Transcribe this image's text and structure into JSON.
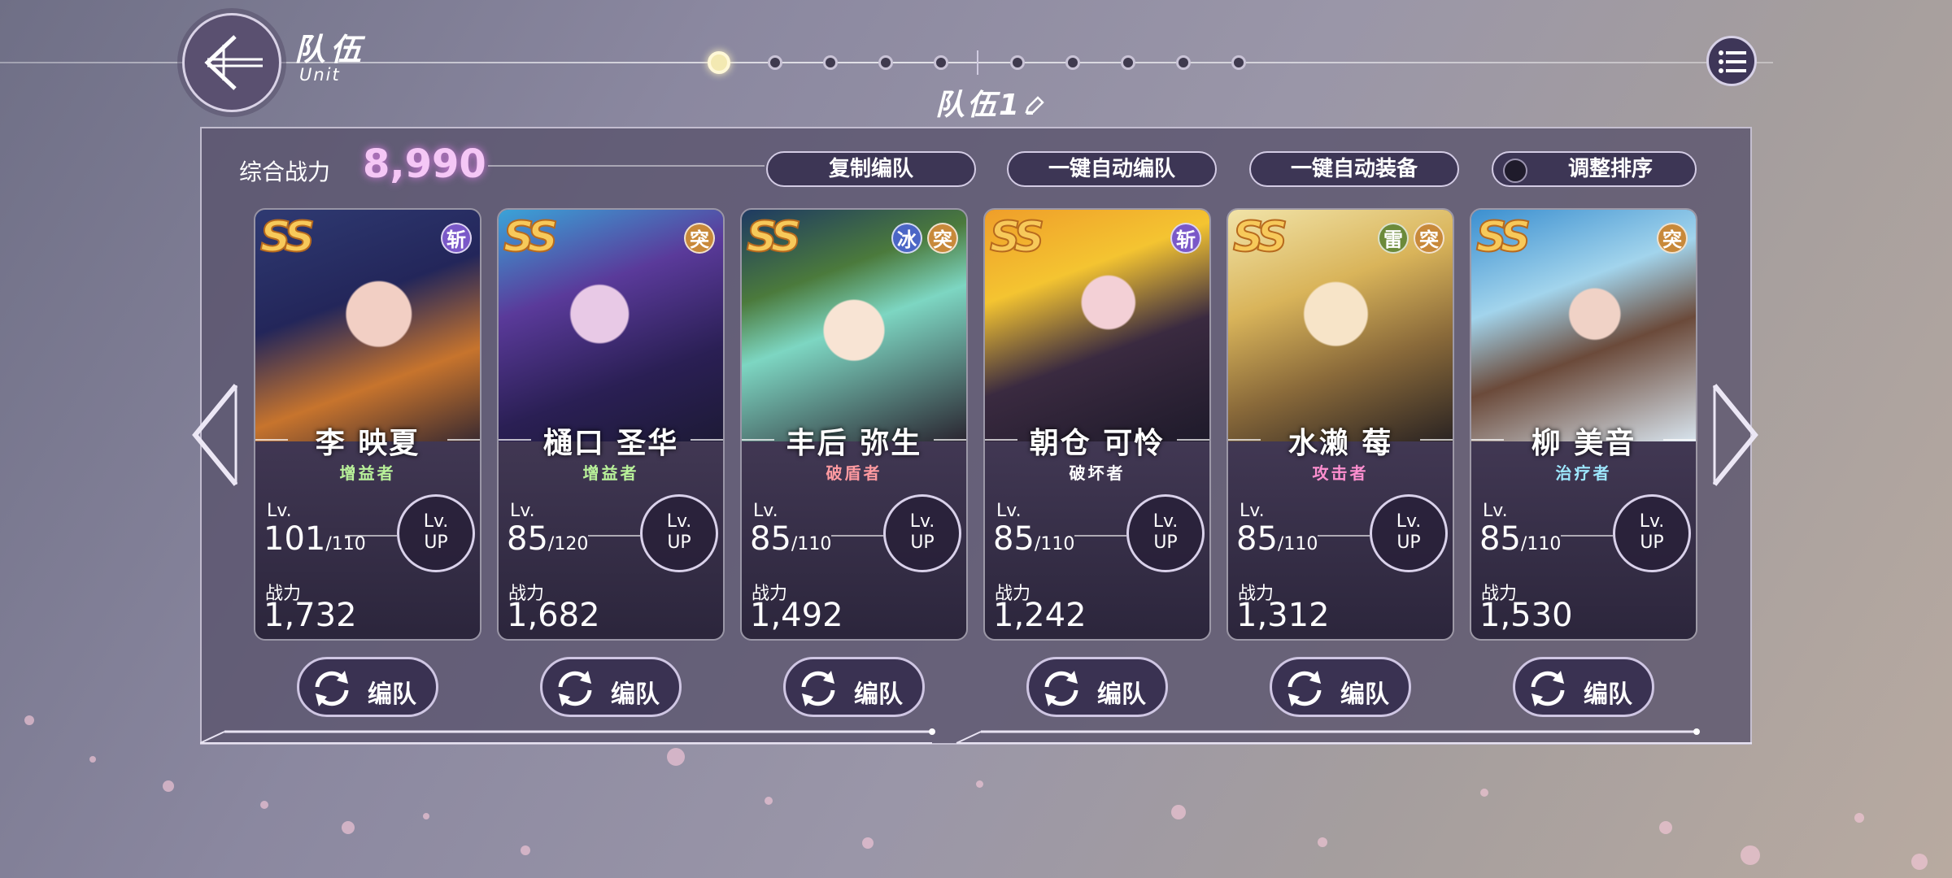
{
  "header": {
    "title": "队伍",
    "subtitle": "Unit",
    "team_name": "队伍1"
  },
  "pagination": {
    "active_index": 0,
    "total": 10
  },
  "summary": {
    "power_label": "综合战力",
    "power_value": "8,990"
  },
  "toolbar": {
    "copy_label": "复制编队",
    "auto_form_label": "一键自动编队",
    "auto_equip_label": "一键自动装备",
    "sort_label": "调整排序"
  },
  "cards": [
    {
      "rank": "SS",
      "name": "李 映夏",
      "role": "增益者",
      "role_color": "#b9f29a",
      "tags": [
        "斩"
      ],
      "lv_label": "Lv.",
      "level": "101",
      "level_max": "/110",
      "lvup_top": "Lv.",
      "lvup_bottom": "UP",
      "power_label": "战力",
      "power": "1,732",
      "edit_label": "编队"
    },
    {
      "rank": "SS",
      "name": "樋口 圣华",
      "role": "增益者",
      "role_color": "#b9f29a",
      "tags": [
        "突"
      ],
      "lv_label": "Lv.",
      "level": "85",
      "level_max": "/120",
      "lvup_top": "Lv.",
      "lvup_bottom": "UP",
      "power_label": "战力",
      "power": "1,682",
      "edit_label": "编队"
    },
    {
      "rank": "SS",
      "name": "丰后 弥生",
      "role": "破盾者",
      "role_color": "#ff9aa0",
      "tags": [
        "冰",
        "突"
      ],
      "lv_label": "Lv.",
      "level": "85",
      "level_max": "/110",
      "lvup_top": "Lv.",
      "lvup_bottom": "UP",
      "power_label": "战力",
      "power": "1,492",
      "edit_label": "编队"
    },
    {
      "rank": "SS",
      "name": "朝仓 可怜",
      "role": "破坏者",
      "role_color": "#ffffff",
      "tags": [
        "斩"
      ],
      "lv_label": "Lv.",
      "level": "85",
      "level_max": "/110",
      "lvup_top": "Lv.",
      "lvup_bottom": "UP",
      "power_label": "战力",
      "power": "1,242",
      "edit_label": "编队"
    },
    {
      "rank": "SS",
      "name": "水濑 莓",
      "role": "攻击者",
      "role_color": "#ff8fd0",
      "tags": [
        "雷",
        "突"
      ],
      "lv_label": "Lv.",
      "level": "85",
      "level_max": "/110",
      "lvup_top": "Lv.",
      "lvup_bottom": "UP",
      "power_label": "战力",
      "power": "1,312",
      "edit_label": "编队"
    },
    {
      "rank": "SS",
      "name": "柳 美音",
      "role": "治疗者",
      "role_color": "#9ee8ff",
      "tags": [
        "突"
      ],
      "lv_label": "Lv.",
      "level": "85",
      "level_max": "/110",
      "lvup_top": "Lv.",
      "lvup_bottom": "UP",
      "power_label": "战力",
      "power": "1,530",
      "edit_label": "编队"
    }
  ],
  "colors": {
    "accent_power": "#f5c7f6",
    "rank_gold": "#f7c95a",
    "panel": "#58526c"
  }
}
